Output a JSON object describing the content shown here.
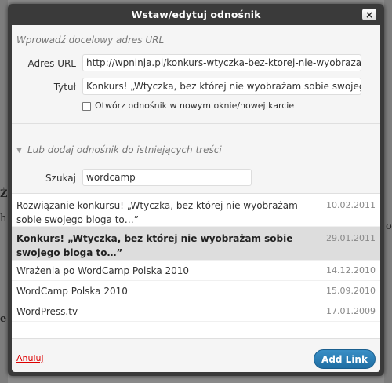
{
  "dialog": {
    "title": "Wstaw/edytuj odnośnik",
    "close_icon": "close-icon",
    "close_glyph": "×"
  },
  "link_section": {
    "heading": "Wprowadź docelowy adres URL",
    "url_label": "Adres URL",
    "url_value": "http://wpninja.pl/konkurs-wtyczka-bez-ktorej-nie-wyobrazam-sobie-swojego-bloga-to/",
    "title_label": "Tytuł",
    "title_value": "Konkurs! „Wtyczka, bez której nie wyobrażam sobie swojego bloga to…”",
    "new_window_label": "Otwórz odnośnik w nowym oknie/nowej karcie",
    "new_window_checked": false
  },
  "existing_section": {
    "toggle_icon": "triangle-down-icon",
    "toggle_glyph": "▼",
    "heading": "Lub dodaj odnośnik do istniejących treści",
    "search_label": "Szukaj",
    "search_value": "wordcamp",
    "results": [
      {
        "title": "Rozwiązanie konkursu! „Wtyczka, bez której nie wyobrażam sobie swojego bloga to…”",
        "date": "10.02.2011",
        "selected": false
      },
      {
        "title": "Konkurs! „Wtyczka, bez której nie wyobrażam sobie swojego bloga to…”",
        "date": "29.01.2011",
        "selected": true
      },
      {
        "title": "Wrażenia po WordCamp Polska 2010",
        "date": "14.12.2010",
        "selected": false
      },
      {
        "title": "WordCamp Polska 2010",
        "date": "15.09.2010",
        "selected": false
      },
      {
        "title": "WordPress.tv",
        "date": "17.01.2009",
        "selected": false
      }
    ]
  },
  "footer": {
    "cancel_label": "Anuluj",
    "submit_label": "Add Link"
  },
  "background": {
    "left_chars": [
      "Ż",
      "h",
      "e"
    ],
    "right_chars": [
      "o"
    ]
  },
  "colors": {
    "accent": "#2583bd",
    "cancel": "#dd0000",
    "selected_row": "#dddddd"
  }
}
